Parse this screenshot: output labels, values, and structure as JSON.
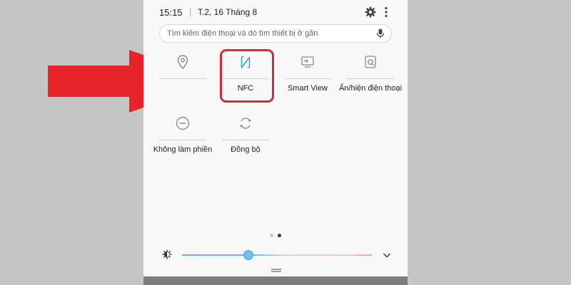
{
  "status_bar": {
    "time": "15:15",
    "separator": "|",
    "date": "T.2, 16 Tháng 8"
  },
  "search": {
    "placeholder": "Tìm kiếm điện thoại và dò tìm thiết bị ở gần"
  },
  "quick_settings": {
    "tiles": [
      {
        "label": "Vị trí",
        "icon": "location-icon",
        "state": "off"
      },
      {
        "label": "NFC",
        "icon": "nfc-icon",
        "state": "off",
        "highlighted": true
      },
      {
        "label": "Smart View",
        "icon": "smart-view-icon",
        "state": "off"
      },
      {
        "label": "Ẩn/hiện điện thoại",
        "icon": "secure-folder-icon",
        "state": "off"
      },
      {
        "label": "Không làm phiền",
        "icon": "do-not-disturb-icon",
        "state": "off"
      },
      {
        "label": "Đồng bộ",
        "icon": "sync-icon",
        "state": "off"
      }
    ]
  },
  "pager": {
    "pages": 2,
    "current": 2
  },
  "brightness": {
    "level": 0.35
  },
  "colors": {
    "highlight": "#d22c3c",
    "arrow": "#e8232a",
    "nfc_icon": "#3aa5c9",
    "slider": "#62b6e6"
  }
}
